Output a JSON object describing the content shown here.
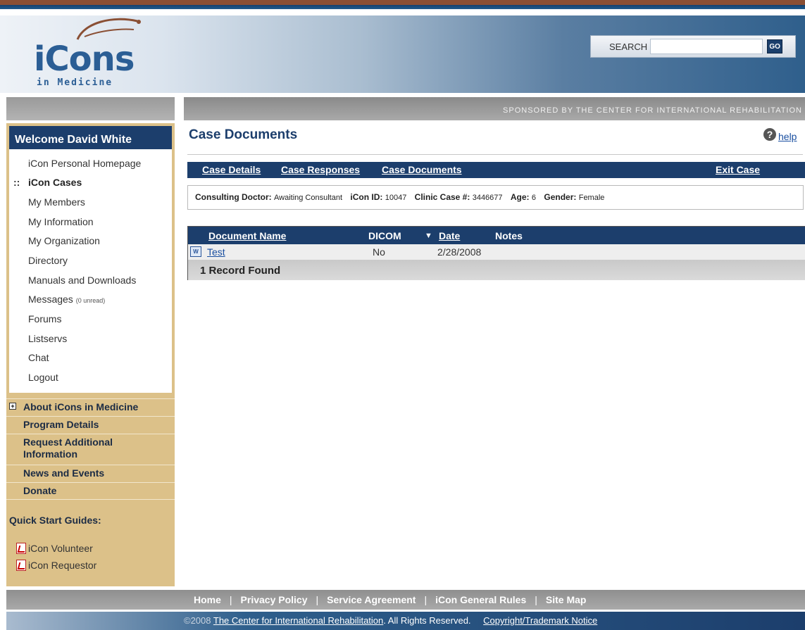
{
  "header": {
    "logo_main": "iCons",
    "logo_sub": "in Medicine",
    "search_label": "SEARCH",
    "search_value": "",
    "go_label": "GO"
  },
  "sponsor": "Sponsored by the Center for International Rehabilitation",
  "sidebar": {
    "welcome": "Welcome David White",
    "bullet": "::",
    "items": [
      {
        "label": "iCon Personal Homepage"
      },
      {
        "label": "iCon Cases"
      },
      {
        "label": "My Members"
      },
      {
        "label": "My Information"
      },
      {
        "label": "My Organization"
      },
      {
        "label": "Directory"
      },
      {
        "label": "Manuals and Downloads"
      },
      {
        "label": "Messages",
        "extra": "(0 unread)"
      },
      {
        "label": "Forums"
      },
      {
        "label": "Listservs"
      },
      {
        "label": "Chat"
      },
      {
        "label": "Logout"
      }
    ],
    "links": [
      {
        "label": "About iCons in Medicine"
      },
      {
        "label": "Program Details"
      },
      {
        "label": "Request Additional Information"
      },
      {
        "label": "News and Events"
      },
      {
        "label": "Donate"
      }
    ],
    "quick_start_title": "Quick Start Guides:",
    "guides": [
      {
        "label": "iCon Volunteer"
      },
      {
        "label": "iCon Requestor"
      }
    ]
  },
  "main": {
    "title": "Case Documents",
    "help": "help",
    "case_nav": {
      "details": "Case Details",
      "responses": "Case Responses",
      "documents": "Case Documents",
      "exit": "Exit Case"
    },
    "info": {
      "doctor_label": "Consulting Doctor:",
      "doctor_value": "Awaiting Consultant",
      "id_label": "iCon ID:",
      "id_value": "10047",
      "clinic_label": "Clinic Case #:",
      "clinic_value": "3446677",
      "age_label": "Age:",
      "age_value": "6",
      "gender_label": "Gender:",
      "gender_value": "Female"
    },
    "table": {
      "headers": {
        "name": "Document Name",
        "dicom": "DICOM",
        "date": "Date",
        "notes": "Notes"
      },
      "rows": [
        {
          "name": "Test",
          "dicom": "No",
          "date": "2/28/2008",
          "notes": ""
        }
      ],
      "footer": "1 Record Found"
    }
  },
  "footer": {
    "links": [
      "Home",
      "Privacy Policy",
      "Service Agreement",
      "iCon General Rules",
      "Site Map"
    ],
    "separator": "|",
    "copyright_prefix": "©2008",
    "copyright_link": "The Center for International Rehabilitation",
    "copyright_suffix": ". All Rights Reserved.",
    "trademark": "Copyright/Trademark Notice"
  },
  "colors": {
    "navy": "#1c3e6c",
    "tan": "#dcc189",
    "rust": "#8a4f34"
  }
}
